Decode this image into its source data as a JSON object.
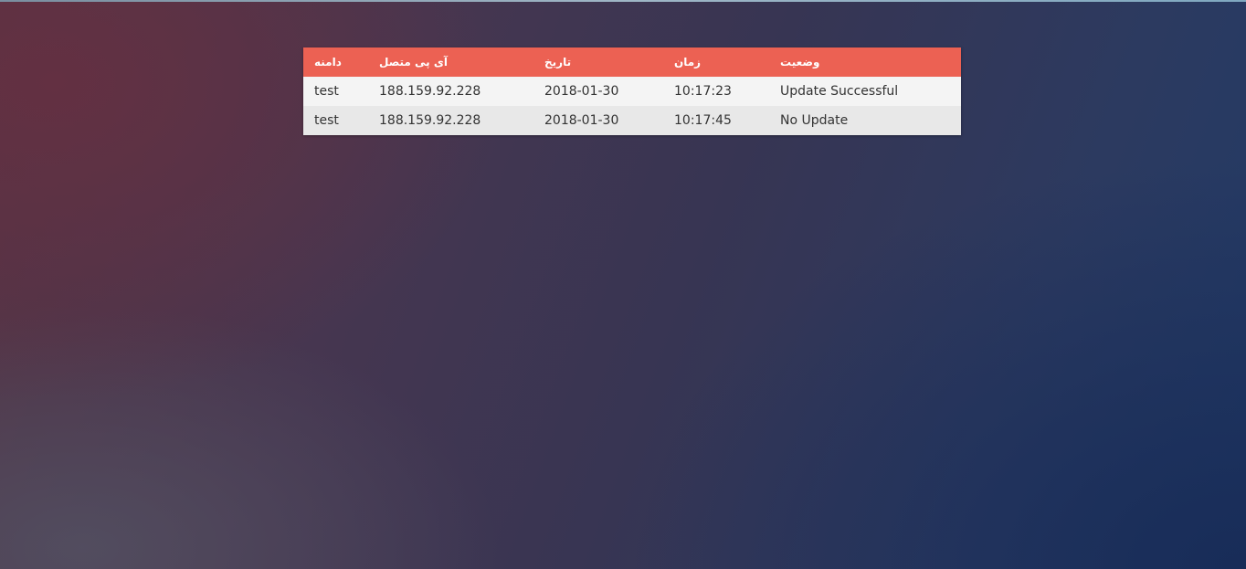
{
  "table": {
    "headers": [
      "دامنه",
      "آی پی متصل",
      "تاریخ",
      "زمان",
      "وضعیت"
    ],
    "rows": [
      [
        "test",
        "188.159.92.228",
        "2018-01-30",
        "10:17:23",
        "Update Successful"
      ],
      [
        "test",
        "188.159.92.228",
        "2018-01-30",
        "10:17:45",
        "No Update"
      ]
    ]
  },
  "colors": {
    "header_bg": "#ec6153",
    "header_text": "#ffffff",
    "row_odd": "#f4f4f4",
    "row_even": "#e8e8e8"
  }
}
